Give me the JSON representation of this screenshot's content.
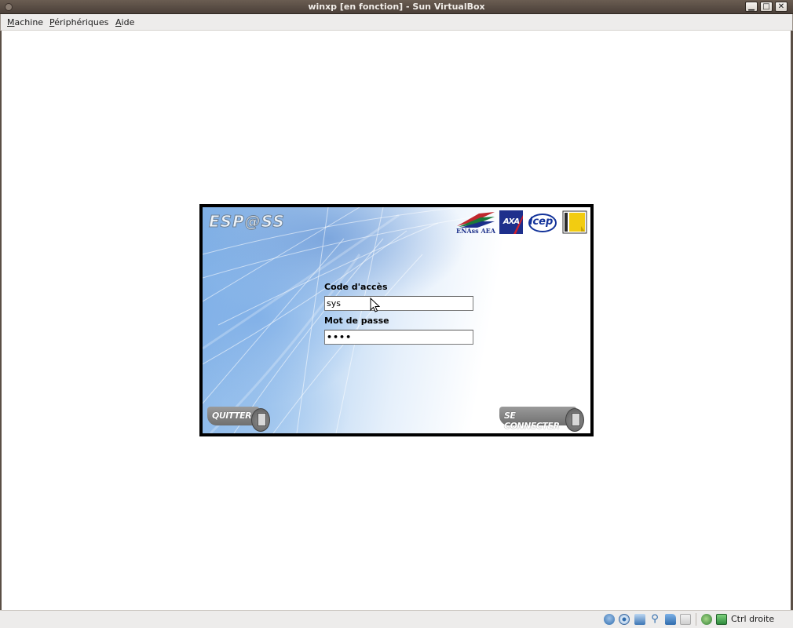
{
  "window": {
    "title": "winxp [en fonction] - Sun VirtualBox",
    "minimize_glyph": "▁",
    "maximize_glyph": "□",
    "close_glyph": "✕"
  },
  "menubar": {
    "items": [
      {
        "label": "Machine",
        "mnemonic": "M",
        "rest": "achine"
      },
      {
        "label": "Périphériques",
        "mnemonic": "P",
        "rest": "ériphériques"
      },
      {
        "label": "Aide",
        "mnemonic": "A",
        "rest": "ide"
      }
    ]
  },
  "login": {
    "logo_text": "ESP@SS",
    "partners": {
      "enass_label": "ENAss AEA",
      "axa_label": "AXA",
      "icep_label": "icep"
    },
    "code_label": "Code d'accès",
    "code_value": "sys",
    "password_label": "Mot de passe",
    "password_value": "••••",
    "quit_label": "QUITTER",
    "connect_label": "SE CONNECTER"
  },
  "statusbar": {
    "host_key_label": "Ctrl droite",
    "icons": [
      "hard-disk-icon",
      "cd-icon",
      "network-icon",
      "usb-icon",
      "shared-folder-icon",
      "screen-icon",
      "virtualization-icon",
      "mouse-integration-icon"
    ]
  },
  "colors": {
    "titlebar": "#4b4039",
    "axa_blue": "#1e2f8c",
    "icep_blue": "#13339a",
    "button_gray": "#7a7a7a"
  }
}
